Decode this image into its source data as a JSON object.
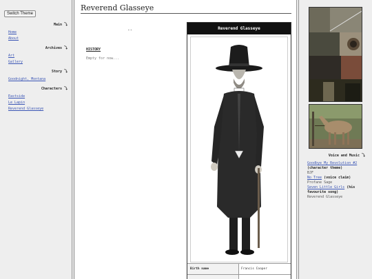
{
  "sidebar": {
    "switch_theme": "Switch Theme",
    "sections": [
      {
        "title": "Main ⤵",
        "links": [
          "Home",
          "About"
        ]
      },
      {
        "title": "Archives ⤵",
        "links": [
          "Art",
          "Gallery"
        ]
      },
      {
        "title": "Story ⤵",
        "links": [
          "Goodnight, Montana"
        ]
      },
      {
        "title": "Characters ⤵",
        "links": [
          "Eastside",
          "Le Lapin",
          "Reverend Glasseye"
        ]
      }
    ]
  },
  "main": {
    "page_title": "Reverend Glasseye",
    "dash": "--",
    "history_heading": "HISTORY",
    "history_text": "Empty for now...",
    "infobox": {
      "title": "Reverend Glasseye",
      "rows": [
        {
          "key": "Birth name",
          "value": "Francis Cooper"
        }
      ]
    }
  },
  "right": {
    "voice_heading": "Voice and Music ⤵",
    "items": [
      {
        "link": "Goodbye My Revolution #2",
        "note": "(character theme)",
        "sub": "BJF"
      },
      {
        "link": "No Tree",
        "note": "(voice claim)",
        "sub": "Profane Sage"
      },
      {
        "link": "Seven Little Girls",
        "note": "(his favourite song)",
        "sub": "Reverend Glasseye"
      }
    ]
  },
  "colors": {
    "link": "#3a55b5",
    "infobox_header": "#111111"
  }
}
